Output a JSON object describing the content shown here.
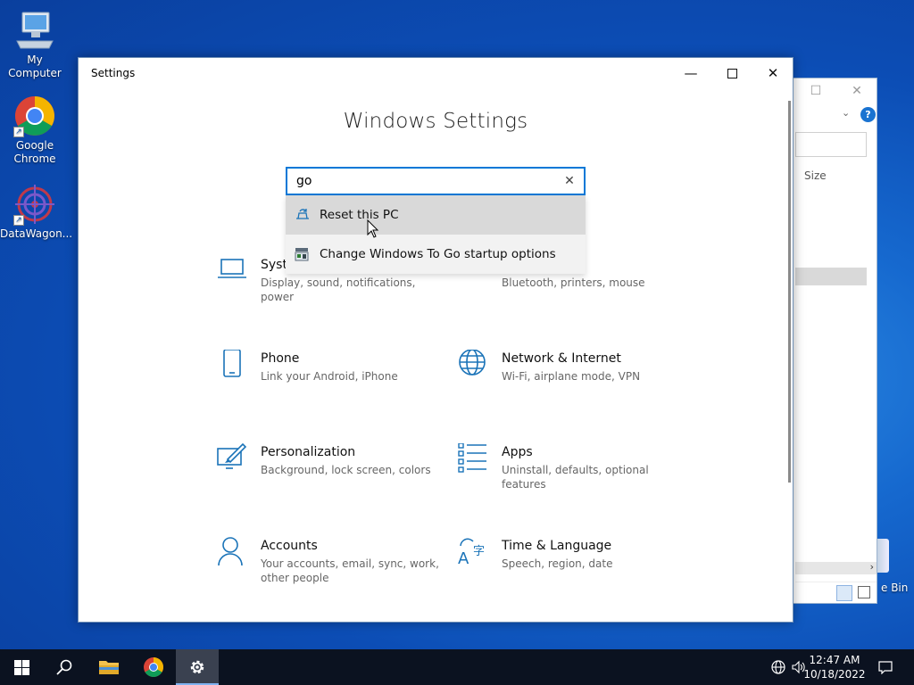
{
  "desktop": {
    "icons": [
      {
        "label": "My Computer"
      },
      {
        "label": "Google Chrome"
      },
      {
        "label": "DataWagon..."
      }
    ],
    "recycle_partial": "e Bin"
  },
  "background_window": {
    "column_size": "Size"
  },
  "settings": {
    "window_title": "Settings",
    "heading": "Windows Settings",
    "search": {
      "value": "go"
    },
    "suggestions": [
      {
        "label": "Reset this PC"
      },
      {
        "label": "Change Windows To Go startup options"
      }
    ],
    "categories": [
      {
        "title": "Syste",
        "desc": "Display, sound, notifications, power"
      },
      {
        "title": "",
        "desc": "Bluetooth, printers, mouse"
      },
      {
        "title": "Phone",
        "desc": "Link your Android, iPhone"
      },
      {
        "title": "Network & Internet",
        "desc": "Wi-Fi, airplane mode, VPN"
      },
      {
        "title": "Personalization",
        "desc": "Background, lock screen, colors"
      },
      {
        "title": "Apps",
        "desc": "Uninstall, defaults, optional features"
      },
      {
        "title": "Accounts",
        "desc": "Your accounts, email, sync, work, other people"
      },
      {
        "title": "Time & Language",
        "desc": "Speech, region, date"
      }
    ]
  },
  "taskbar": {
    "time": "12:47 AM",
    "date": "10/18/2022"
  },
  "colors": {
    "accent": "#0078d7",
    "icon_blue": "#1a73b8",
    "taskbar": "#0b1220"
  }
}
